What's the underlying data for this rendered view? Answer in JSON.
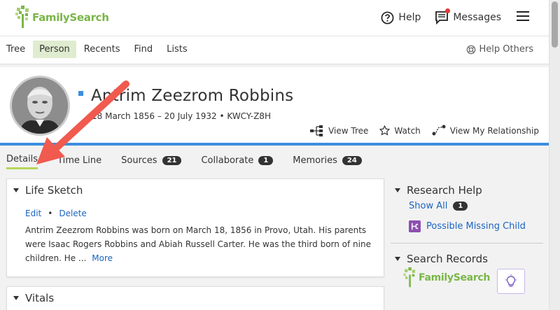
{
  "brand": {
    "name": "FamilySearch",
    "color": "#7ab648"
  },
  "header": {
    "help_label": "Help",
    "messages_label": "Messages",
    "menu_icon": "hamburger-icon"
  },
  "nav": {
    "items": [
      {
        "label": "Tree",
        "active": false
      },
      {
        "label": "Person",
        "active": true
      },
      {
        "label": "Recents",
        "active": false
      },
      {
        "label": "Find",
        "active": false
      },
      {
        "label": "Lists",
        "active": false
      }
    ],
    "help_others": "Help Others"
  },
  "person": {
    "name": "Antrim Zeezrom Robbins",
    "vitals": "18 March 1856 – 20 July 1932 • KWCY-Z8H",
    "actions": {
      "view_tree": "View Tree",
      "watch": "Watch",
      "view_relationship": "View My Relationship"
    },
    "accent_color": "#3b8ede"
  },
  "tabs": [
    {
      "label": "Details",
      "badge": null,
      "active": true
    },
    {
      "label": "Time Line",
      "badge": null,
      "active": false
    },
    {
      "label": "Sources",
      "badge": "21",
      "active": false
    },
    {
      "label": "Collaborate",
      "badge": "1",
      "active": false
    },
    {
      "label": "Memories",
      "badge": "24",
      "active": false
    }
  ],
  "life_sketch": {
    "title": "Life Sketch",
    "edit": "Edit",
    "bullet": "•",
    "delete": "Delete",
    "text": "Antrim Zeezrom Robbins was born on March 18, 1856 in Provo, Utah. His parents were Isaac Rogers Robbins and Abiah Russell Carter. He was the third born of nine children. He ...",
    "more": "More"
  },
  "vitals_card": {
    "title": "Vitals"
  },
  "research_help": {
    "title": "Research Help",
    "show_all": "Show All",
    "count": "1",
    "hint": "Possible Missing Child"
  },
  "search_records": {
    "title": "Search Records",
    "source": "FamilySearch"
  }
}
